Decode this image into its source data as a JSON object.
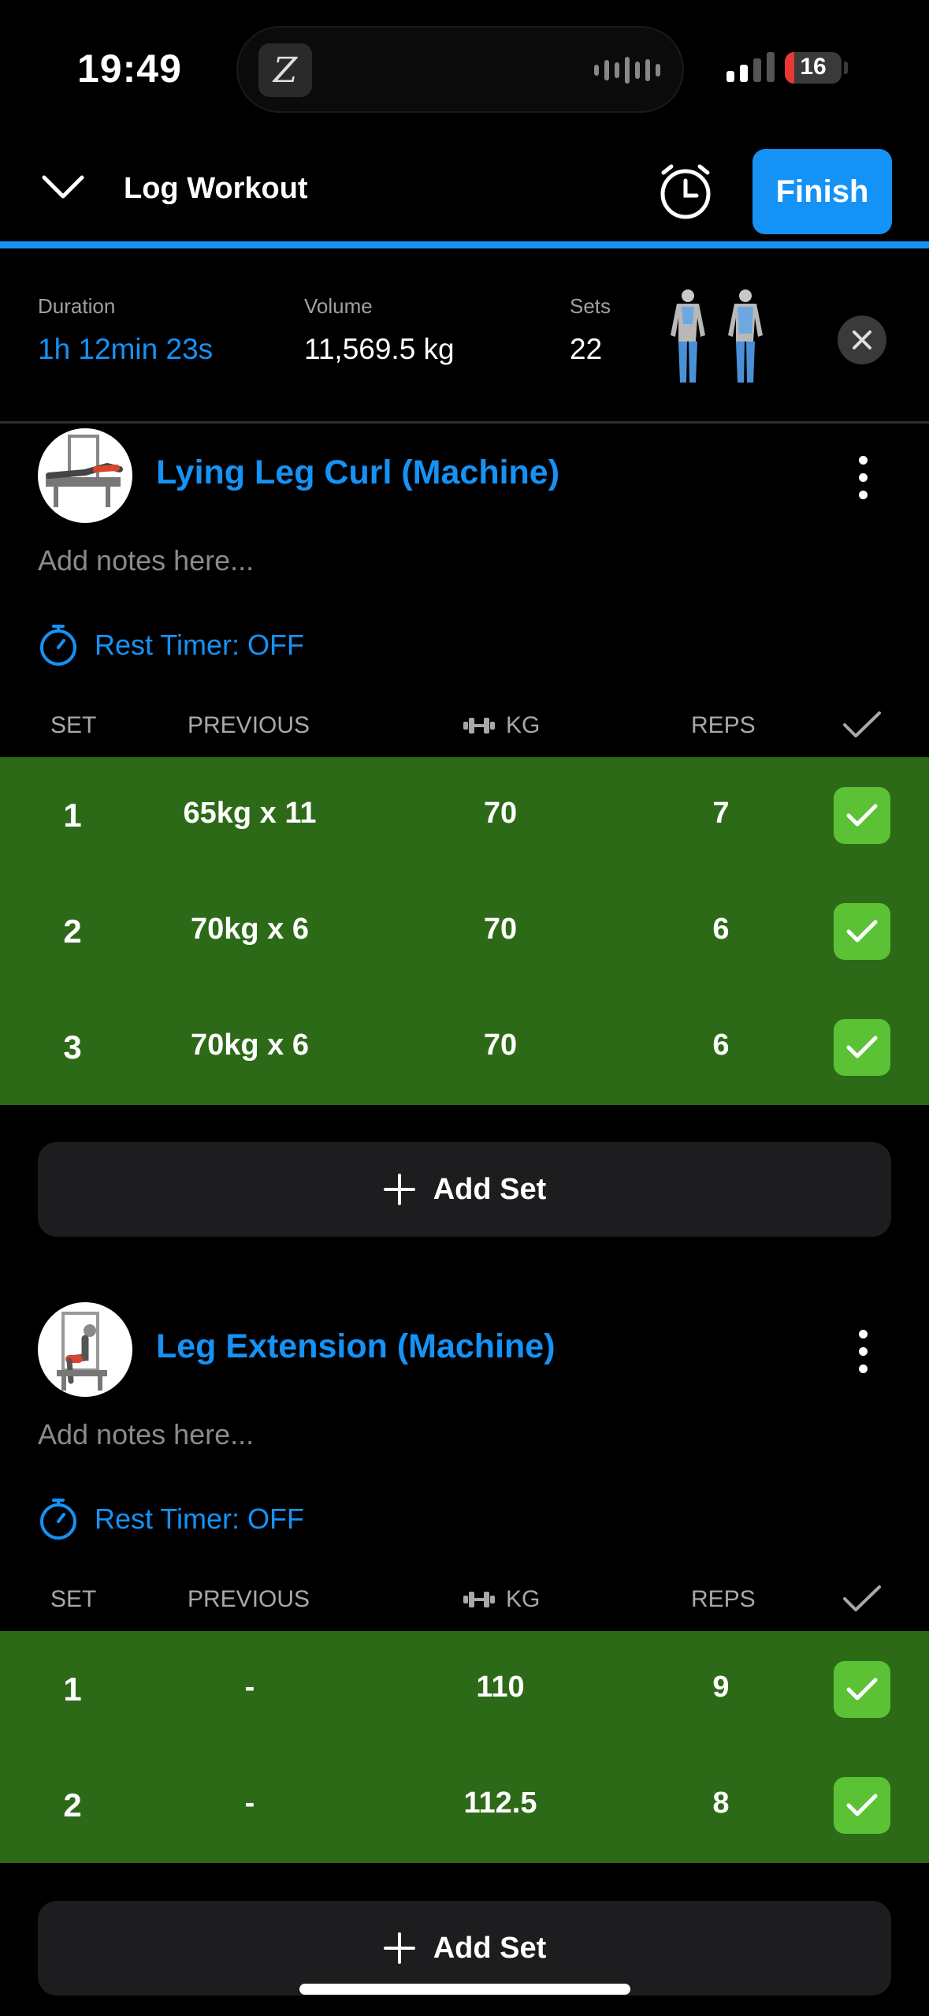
{
  "status_bar": {
    "time": "19:49",
    "battery": "16"
  },
  "header": {
    "title": "Log Workout",
    "finish_label": "Finish"
  },
  "stats": {
    "duration_label": "Duration",
    "duration_value": "1h 12min 23s",
    "volume_label": "Volume",
    "volume_value": "11,569.5 kg",
    "sets_label": "Sets",
    "sets_value": "22"
  },
  "columns": {
    "set": "SET",
    "previous": "PREVIOUS",
    "kg": "KG",
    "reps": "REPS"
  },
  "exercises": [
    {
      "title": "Lying Leg Curl (Machine)",
      "notes_placeholder": "Add notes here...",
      "rest_timer": "Rest Timer: OFF",
      "sets": [
        {
          "set": "1",
          "previous": "65kg x 11",
          "kg": "70",
          "reps": "7"
        },
        {
          "set": "2",
          "previous": "70kg x 6",
          "kg": "70",
          "reps": "6"
        },
        {
          "set": "3",
          "previous": "70kg x 6",
          "kg": "70",
          "reps": "6"
        }
      ],
      "add_set_label": "Add Set"
    },
    {
      "title": "Leg Extension (Machine)",
      "notes_placeholder": "Add notes here...",
      "rest_timer": "Rest Timer: OFF",
      "sets": [
        {
          "set": "1",
          "previous": "-",
          "kg": "110",
          "reps": "9"
        },
        {
          "set": "2",
          "previous": "-",
          "kg": "112.5",
          "reps": "8"
        }
      ],
      "add_set_label": "Add Set"
    }
  ],
  "colors": {
    "accent": "#1592f6",
    "completed_row": "#2d6a18",
    "check": "#5bc236"
  }
}
